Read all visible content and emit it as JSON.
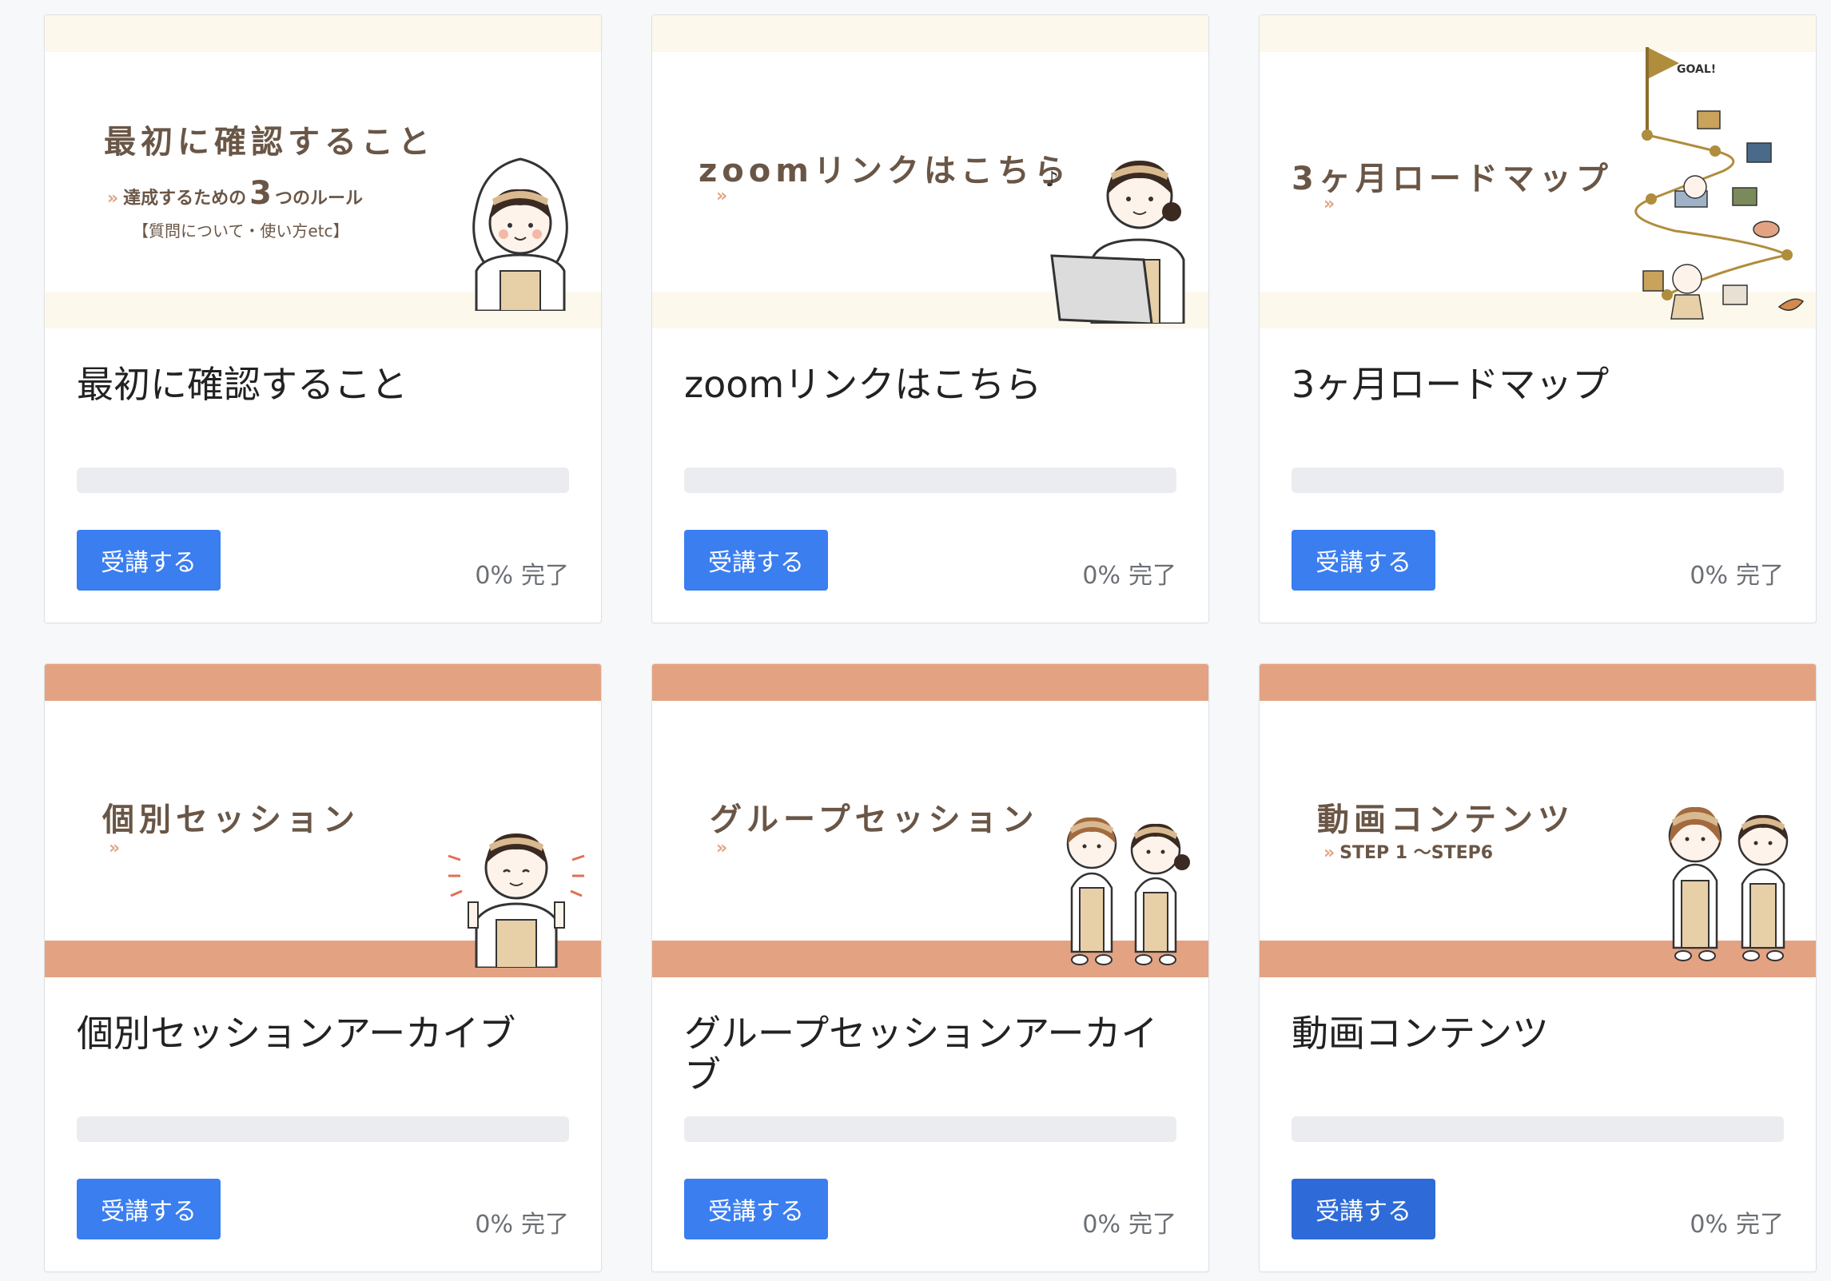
{
  "cards": [
    {
      "thumb_title": "最初に確認すること",
      "thumb_sub1": "達成するための",
      "thumb_sub_num": "3",
      "thumb_sub2": "つのルール",
      "thumb_sub3": "【質問について・使い方etc】",
      "title": "最初に確認すること",
      "button": "受講する",
      "progress_percent": 0,
      "progress_text": "0%",
      "progress_label": "完了"
    },
    {
      "thumb_title": "zoomリンクはこちら",
      "title": "zoomリンクはこちら",
      "button": "受講する",
      "progress_percent": 0,
      "progress_text": "0%",
      "progress_label": "完了"
    },
    {
      "thumb_title": "3ヶ月ロードマップ",
      "thumb_goal": "GOAL!",
      "title": "3ヶ月ロードマップ",
      "button": "受講する",
      "progress_percent": 0,
      "progress_text": "0%",
      "progress_label": "完了"
    },
    {
      "thumb_title": "個別セッション",
      "title": "個別セッションアーカイブ",
      "button": "受講する",
      "progress_percent": 0,
      "progress_text": "0%",
      "progress_label": "完了"
    },
    {
      "thumb_title": "グループセッション",
      "title": "グループセッションアーカイブ",
      "button": "受講する",
      "progress_percent": 0,
      "progress_text": "0%",
      "progress_label": "完了"
    },
    {
      "thumb_title": "動画コンテンツ",
      "thumb_sub1": "STEP 1 〜STEP6",
      "title": "動画コンテンツ",
      "button": "受講する",
      "progress_percent": 0,
      "progress_text": "0%",
      "progress_label": "完了"
    }
  ],
  "colors": {
    "primary_button": "#3a7ef0",
    "primary_button_hover": "#2e6bd8",
    "accent_peach": "#e3a383",
    "accent_cream": "#fdf8ec",
    "thumb_text": "#6a5646"
  }
}
